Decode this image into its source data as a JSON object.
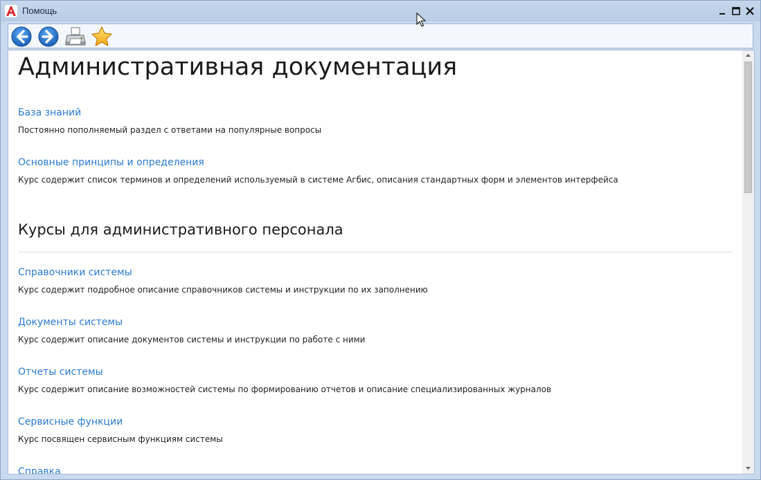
{
  "window": {
    "title": "Помощь",
    "app_icon": "agbis-logo-icon"
  },
  "toolbar": {
    "buttons": [
      {
        "name": "back",
        "icon": "arrow-left-icon"
      },
      {
        "name": "forward",
        "icon": "arrow-right-icon"
      },
      {
        "name": "print",
        "icon": "printer-icon"
      },
      {
        "name": "favorites",
        "icon": "star-icon"
      }
    ]
  },
  "page": {
    "title": "Административная документация",
    "intro_items": [
      {
        "link": "База знаний",
        "desc": "Постоянно пополняемый раздел с ответами на популярные вопросы"
      },
      {
        "link": "Основные принципы и определения",
        "desc": "Курс содержит список терминов и определений используемый в системе Агбис, описания стандартных форм и элементов интерфейса"
      }
    ],
    "section": {
      "title": "Курсы для административного персонала",
      "items": [
        {
          "link": "Справочники системы",
          "desc": "Курс содержит подробное описание справочников системы и инструкции по их заполнению"
        },
        {
          "link": "Документы системы",
          "desc": "Курс содержит описание документов системы и инструкции по работе с ними"
        },
        {
          "link": "Отчеты системы",
          "desc": "Курс содержит описание возможностей системы по формированию отчетов и описание специализированных журналов"
        },
        {
          "link": "Сервисные функции",
          "desc": "Курс посвящен сервисным функциям системы"
        },
        {
          "link": "Справка",
          "desc": ""
        }
      ]
    }
  },
  "colors": {
    "link": "#2a7ad2",
    "titlebar": "#c6d6ec",
    "accent_red": "#d8262b"
  }
}
